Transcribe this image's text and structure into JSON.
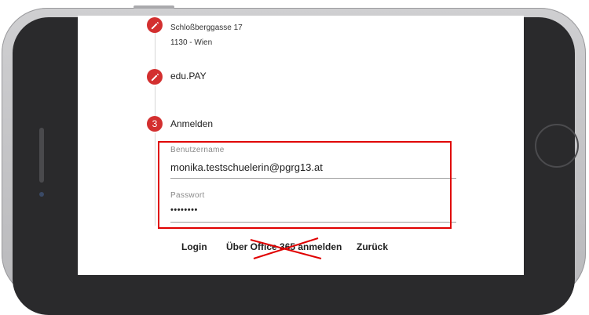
{
  "steps": [
    {
      "address_line1": "Schloßberggasse 17",
      "address_line2": "1130 - Wien"
    },
    {
      "label": "edu.PAY",
      "icon": "pencil-icon"
    },
    {
      "number": "3",
      "label": "Anmelden"
    }
  ],
  "form": {
    "username_label": "Benutzername",
    "username_value": "monika.testschuelerin@pgrg13.at",
    "password_label": "Passwort",
    "password_value": "••••••••"
  },
  "buttons": {
    "login": "Login",
    "office365": "Über Office 365 anmelden",
    "back": "Zurück"
  },
  "colors": {
    "accent": "#d32f2f",
    "highlight": "#e00000"
  }
}
